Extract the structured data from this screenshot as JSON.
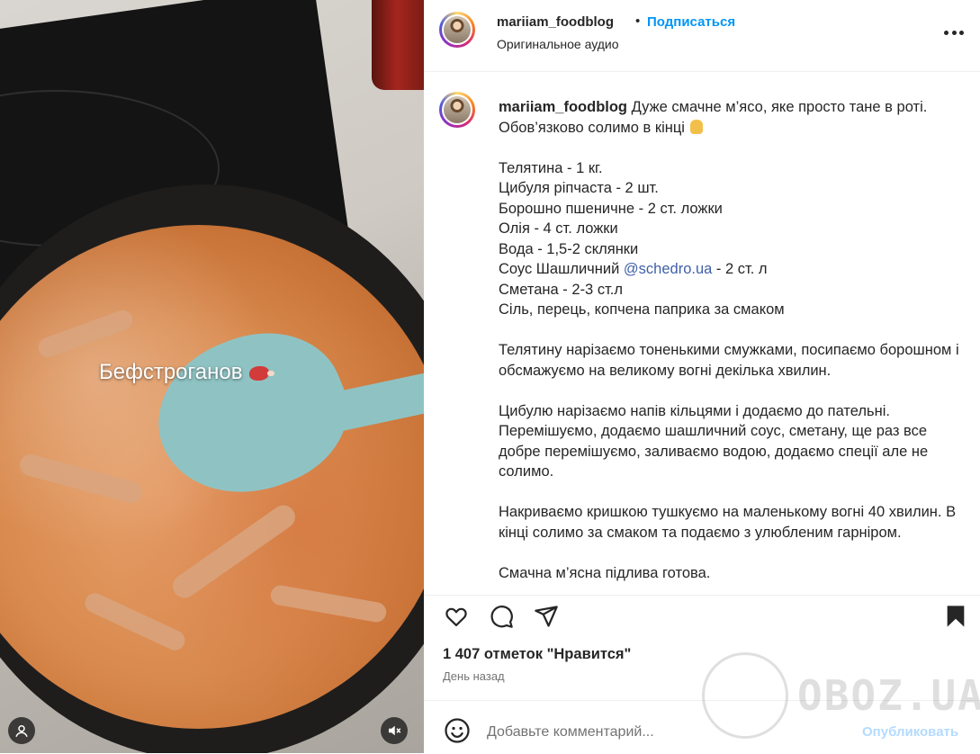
{
  "media": {
    "overlay_text": "Бефстроганов",
    "icons": [
      "user-tag-icon",
      "muted-audio-icon"
    ]
  },
  "post": {
    "username": "mariiam_foodblog",
    "separator": "•",
    "follow_label": "Подписаться",
    "audio_label": "Оригинальное аудио"
  },
  "caption": {
    "username": "mariiam_foodblog",
    "intro": "Дуже смачне м’ясо, яке просто тане в роті. Обов’язково солимо в кінці",
    "ingredients": [
      "Телятина - 1 кг.",
      "Цибуля ріпчаста - 2 шт.",
      "Борошно пшеничне - 2 ст. ложки",
      "Олія - 4 ст. ложки",
      "Вода - 1,5-2 склянки"
    ],
    "sauce_prefix": "Соус Шашличний ",
    "sauce_mention": "@schedro.ua",
    "sauce_suffix": " - 2 ст. л",
    "ingredients_after": [
      "Сметана - 2-3 ст.л",
      "Сіль, перець, копчена паприка за смаком"
    ],
    "step1": "Телятину нарізаємо тоненькими смужками, посипаємо борошном і обсмажуємо на великому вогні декілька хвилин.",
    "step2": "Цибулю нарізаємо напів кільцями і додаємо до пательні. Перемішуємо, додаємо шашличний соус, сметану, ще раз все добре перемішуємо, заливаємо водою, додаємо спеції але не солимо.",
    "step3": "Накриваємо кришкою тушкуємо на маленькому вогні 40 хвилин. В кінці солимо за смаком та подаємо з улюбленим гарніром.",
    "step4": "Смачна м’ясна підлива готова."
  },
  "actions": {
    "icons": [
      "heart-icon",
      "comment-icon",
      "share-icon",
      "bookmark-icon"
    ]
  },
  "likes_text": "1 407 отметок \"Нравится\"",
  "time_text": "День назад",
  "comment": {
    "placeholder": "Добавьте комментарий...",
    "publish_label": "Опубликовать"
  },
  "watermark": "OBOZ.UA",
  "colors": {
    "link": "#0095f6",
    "mention": "#3f5fa8",
    "publish_disabled": "#b3dbff",
    "secondary_text": "#737373"
  }
}
